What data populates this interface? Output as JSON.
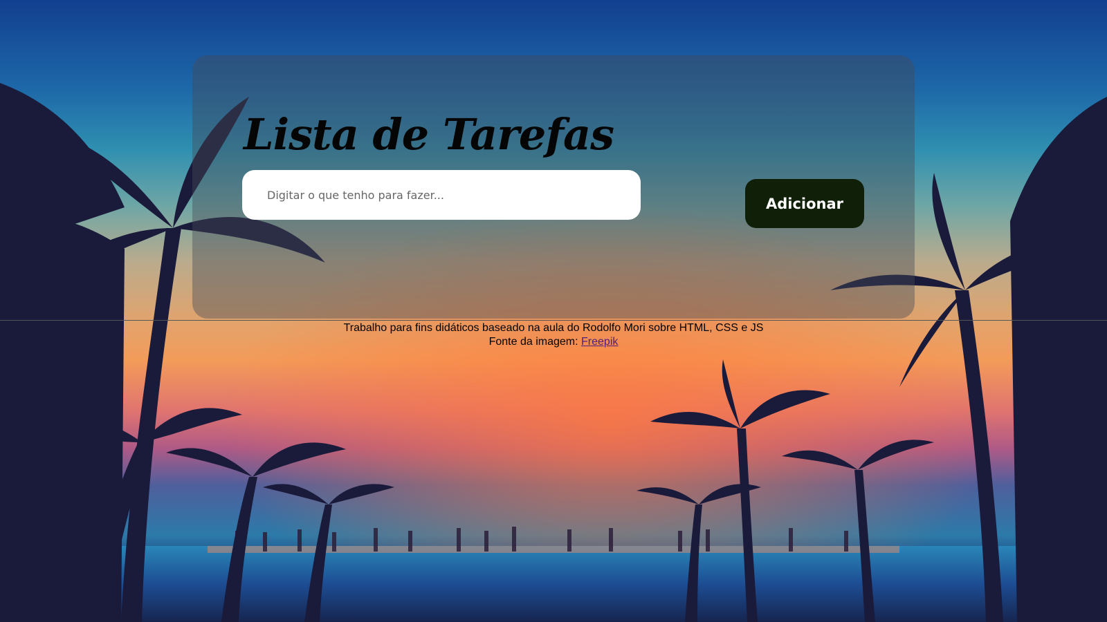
{
  "app": {
    "title": "Lista de Tarefas"
  },
  "task_form": {
    "input_placeholder": "Digitar o que tenho para fazer...",
    "input_value": "",
    "add_button_label": "Adicionar"
  },
  "footer": {
    "credit_text": "Trabalho para fins didáticos baseado na aula do Rodolfo Mori sobre HTML, CSS e JS",
    "image_source_prefix": "Fonte da imagem:",
    "image_source_link": "Freepik"
  },
  "colors": {
    "button_background": "#0f1f08",
    "link": "#4b1f7a"
  }
}
